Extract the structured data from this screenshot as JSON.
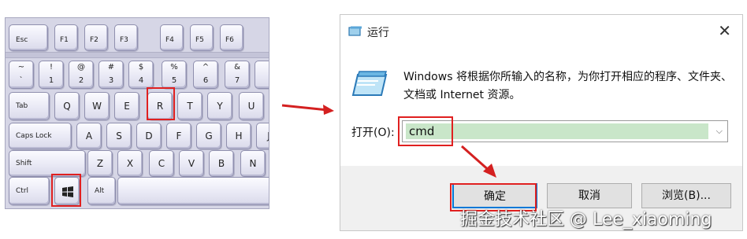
{
  "keyboard": {
    "row_fn": [
      "Esc",
      "F1",
      "F2",
      "F3",
      "F4",
      "F5",
      "F6"
    ],
    "row_num": [
      {
        "top": "~",
        "bottom": "`"
      },
      {
        "top": "!",
        "bottom": "1"
      },
      {
        "top": "@",
        "bottom": "2"
      },
      {
        "top": "#",
        "bottom": "3"
      },
      {
        "top": "$",
        "bottom": "4"
      },
      {
        "top": "%",
        "bottom": "5"
      },
      {
        "top": "^",
        "bottom": "6"
      },
      {
        "top": "&",
        "bottom": "7"
      }
    ],
    "row_tab": [
      "Tab",
      "Q",
      "W",
      "E",
      "R",
      "T",
      "Y",
      "U"
    ],
    "row_caps": [
      "Caps Lock",
      "A",
      "S",
      "D",
      "F",
      "G",
      "H",
      "J"
    ],
    "row_shift": [
      "Shift",
      "Z",
      "X",
      "C",
      "V",
      "B",
      "N"
    ],
    "row_ctrl": [
      "Ctrl",
      "",
      "Alt",
      ""
    ],
    "windows_key_icon": "windows-logo-icon",
    "highlight_color": "#e02020"
  },
  "dialog": {
    "title": "运行",
    "close_glyph": "✕",
    "description": "Windows 将根据你所输入的名称，为你打开相应的程序、文件夹、文档或 Internet 资源。",
    "open_label": "打开(O):",
    "open_value": "cmd",
    "dropdown_glyph": "⌵",
    "buttons": {
      "ok": "确定",
      "cancel": "取消",
      "browse": "浏览(B)..."
    },
    "accent": "#0078d7",
    "input_fill": "#c9e6c9"
  },
  "watermark": "掘金技术社区 @ Lee_xiaoming"
}
